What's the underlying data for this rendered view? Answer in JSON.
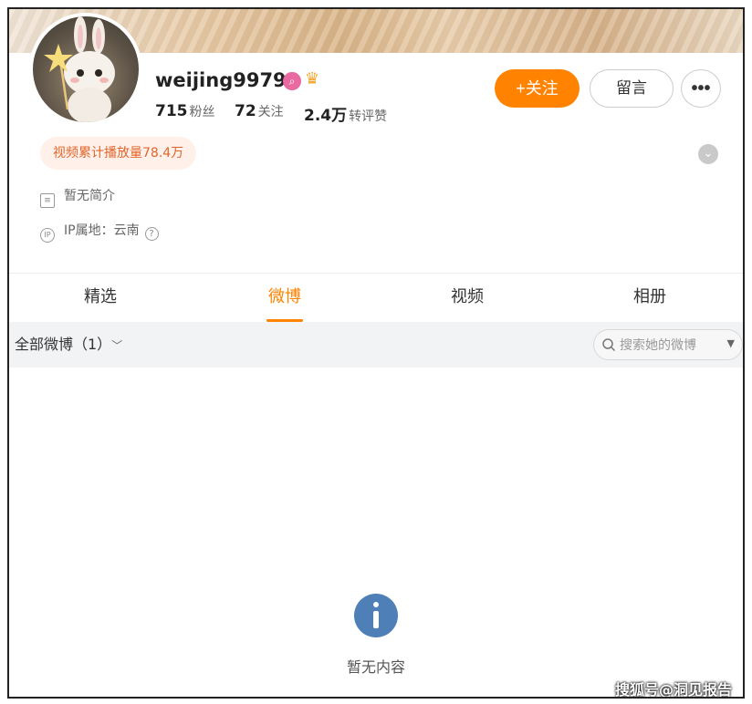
{
  "profile": {
    "username": "weijing99793",
    "badge_pink_icon": "pink-v-badge-icon",
    "badge_crown_icon": "crown-icon",
    "stats": [
      {
        "num": "715",
        "label": "粉丝"
      },
      {
        "num": "72",
        "label": "关注"
      },
      {
        "num": "2.4万",
        "label": "转评赞"
      }
    ],
    "follow_label": "+关注",
    "message_label": "留言",
    "more_label": "•••",
    "video_plays": "视频累计播放量78.4万",
    "bio": "暂无简介",
    "ip_location": "IP属地：云南"
  },
  "tabs": [
    {
      "label": "精选",
      "active": false
    },
    {
      "label": "微博",
      "active": true
    },
    {
      "label": "视频",
      "active": false
    },
    {
      "label": "相册",
      "active": false
    }
  ],
  "filter": {
    "label": "全部微博（1）",
    "search_placeholder": "搜索她的微博"
  },
  "empty_state": {
    "text": "暂无内容"
  },
  "watermark": "搜狐号@洞见报告",
  "colors": {
    "accent": "#ff8200",
    "info_icon": "#4e7fb6",
    "play_pill_bg": "#fff1ea",
    "play_pill_text": "#e0652c"
  }
}
